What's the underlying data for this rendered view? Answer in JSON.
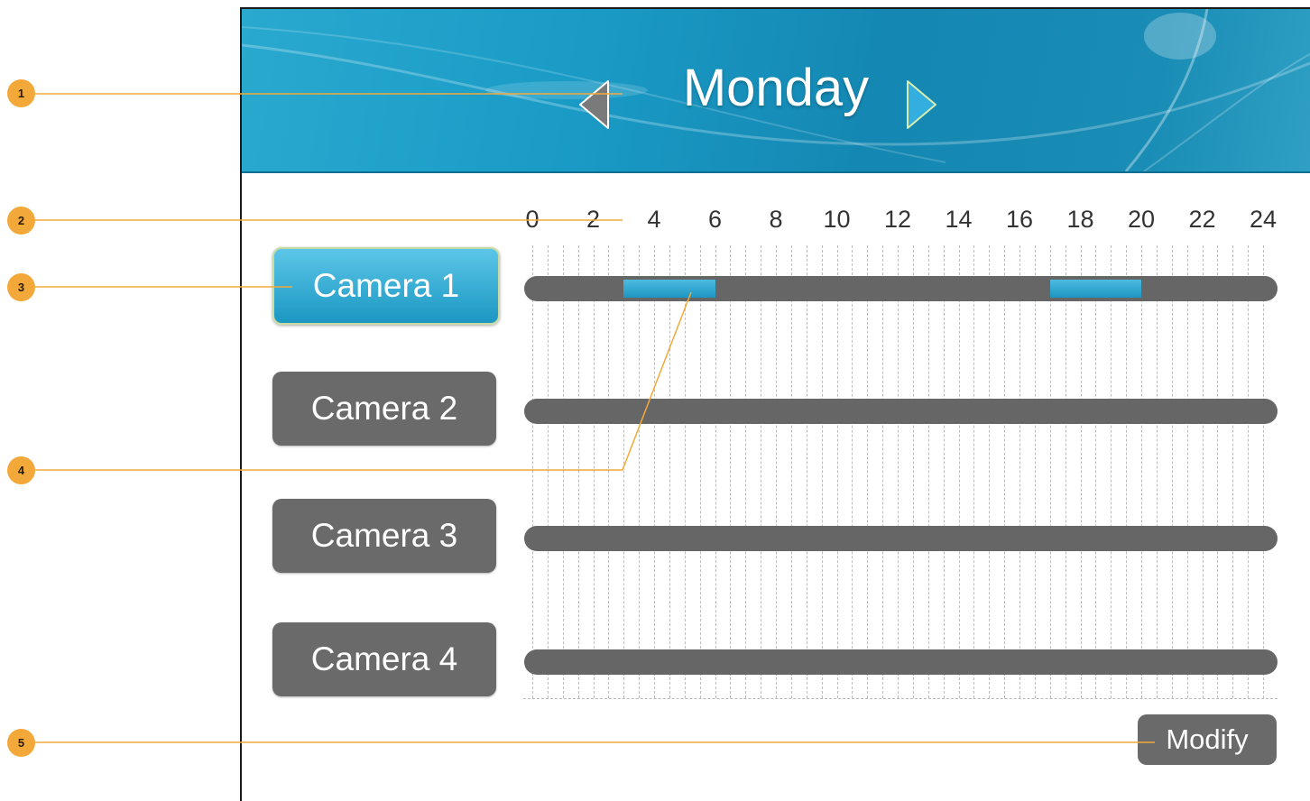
{
  "header": {
    "day": "Monday"
  },
  "schedule": {
    "hours": [
      "0",
      "2",
      "4",
      "6",
      "8",
      "10",
      "12",
      "14",
      "16",
      "18",
      "20",
      "22",
      "24"
    ],
    "cameras": [
      {
        "label": "Camera 1",
        "active": true,
        "segments": [
          [
            3,
            6
          ],
          [
            17,
            20
          ]
        ]
      },
      {
        "label": "Camera 2",
        "active": false,
        "segments": []
      },
      {
        "label": "Camera 3",
        "active": false,
        "segments": []
      },
      {
        "label": "Camera 4",
        "active": false,
        "segments": []
      }
    ]
  },
  "actions": {
    "modify_label": "Modify"
  },
  "callouts": [
    "1",
    "2",
    "3",
    "4",
    "5"
  ],
  "colors": {
    "accent": "#1b97c2",
    "track": "#666666",
    "callout": "#f3a93a"
  }
}
